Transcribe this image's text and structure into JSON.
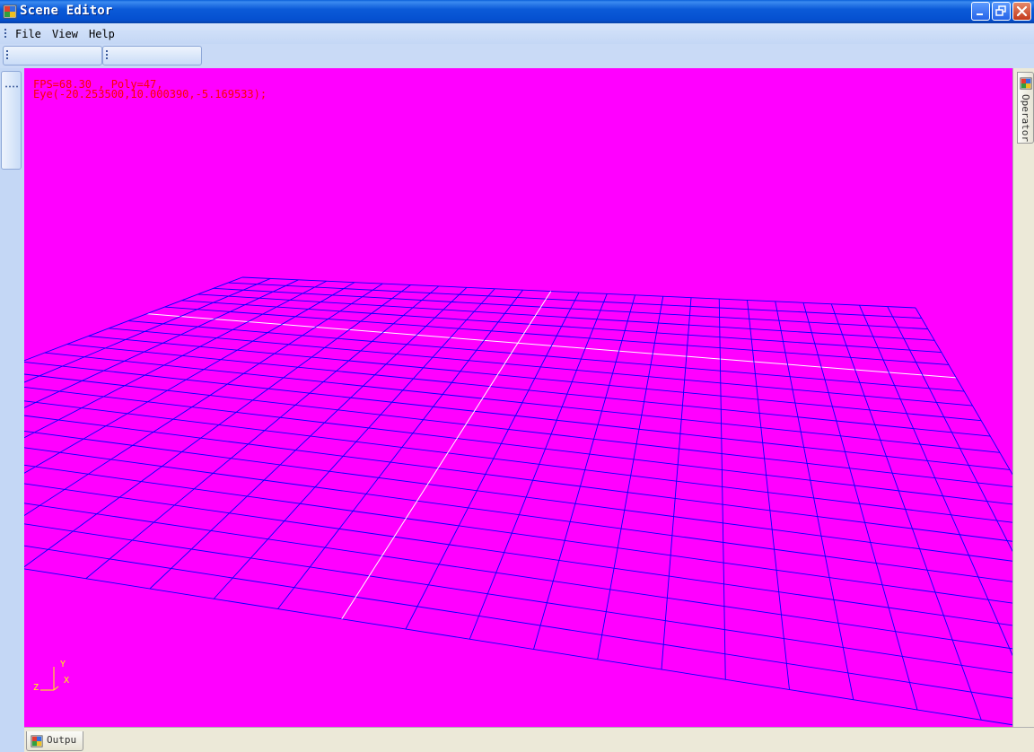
{
  "window": {
    "title": "Scene Editor"
  },
  "menu": {
    "items": [
      {
        "label": "File"
      },
      {
        "label": "View"
      },
      {
        "label": "Help"
      }
    ]
  },
  "viewport": {
    "background_color": "#ff00ff",
    "grid_color": "#0000ff",
    "axis_line_color": "#ffffff",
    "hud": {
      "fps_line": "FPS=68.30 , Poly=47,",
      "eye_line": "Eye(-20.253500,10.000390,-5.169533);",
      "text_color": "#ff0000"
    },
    "axis_gizmo": {
      "y_label": "Y",
      "x_label": "X",
      "z_label": "Z",
      "color": "#ffff00"
    }
  },
  "right_dock": {
    "tab_label": "Operator"
  },
  "bottom_dock": {
    "tab_label": "Outpu"
  }
}
